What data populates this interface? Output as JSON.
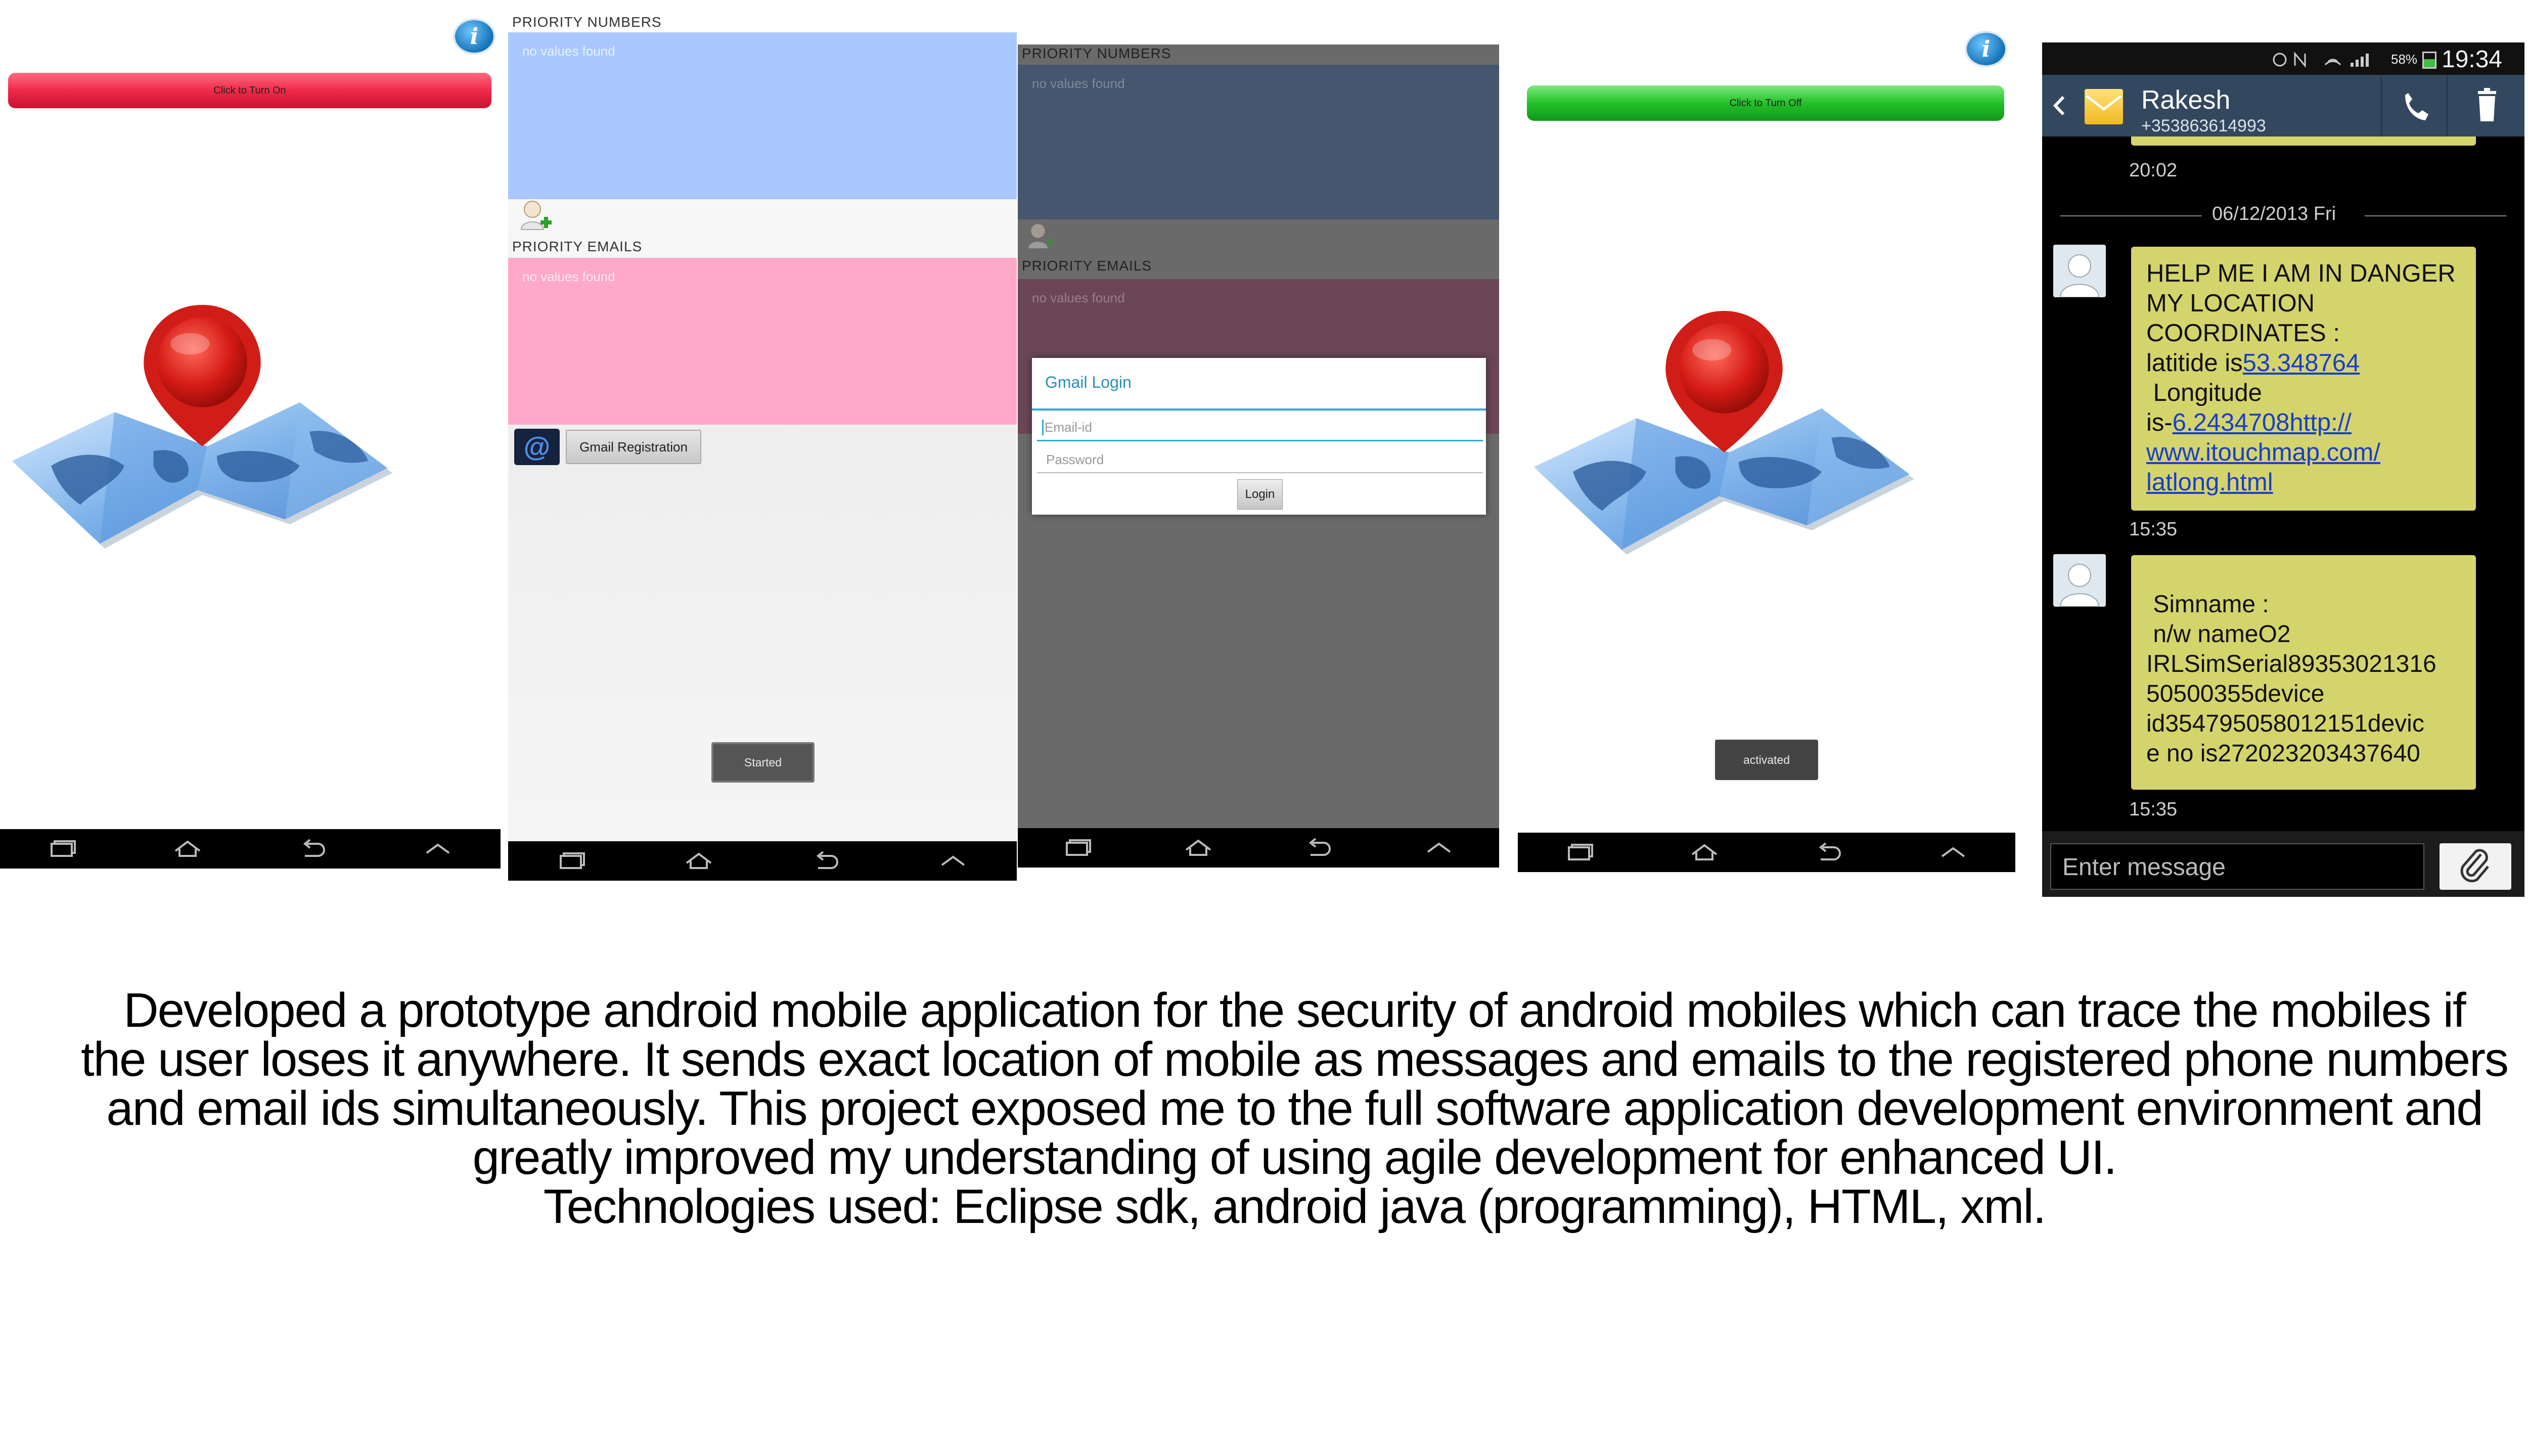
{
  "screen1": {
    "info_label": "i",
    "toggle_label": "Click to Turn On",
    "toggle_color": "#ee2a4a"
  },
  "screen2": {
    "priority_numbers_title": "PRIORITY NUMBERS",
    "numbers_empty": "no values found",
    "priority_emails_title": "PRIORITY EMAILS",
    "emails_empty": "no values found",
    "gmail_registration_label": "Gmail Registration",
    "started_label": "Started",
    "numbers_color": "#a8c8ff",
    "emails_color": "#ffa8c8"
  },
  "screen3": {
    "priority_numbers_title": "PRIORITY NUMBERS",
    "numbers_empty": "no values found",
    "priority_emails_title": "PRIORITY EMAILS",
    "emails_empty": "no values found",
    "dialog": {
      "title": "Gmail Login",
      "email_placeholder": "Email-id",
      "password_placeholder": "Password",
      "login_label": "Login"
    }
  },
  "screen4": {
    "info_label": "i",
    "toggle_label": "Click to Turn Off",
    "toggle_color": "#22c22a",
    "activated_label": "activated"
  },
  "screen5": {
    "status_bar": {
      "battery": "58%",
      "time": "19:34"
    },
    "contact_name": "Rakesh",
    "contact_number": "+353863614993",
    "earlier_time": "20:02",
    "date_divider": "06/12/2013 Fri",
    "message1": {
      "lines": [
        "HELP ME I AM IN DANGER",
        "MY LOCATION",
        "COORDINATES :"
      ],
      "latitude_prefix": "latitide is",
      "latitude_value": "53.348764",
      "longitude_label": " Longitude",
      "longitude_prefix": "is-",
      "longitude_link_1": "6.2434708http://",
      "link_2": "www.itouchmap.com/",
      "link_3": "latlong.html",
      "time": "15:35"
    },
    "message2": {
      "lines": [
        " Simname :",
        " n/w nameO2",
        "IRLSimSerial89353021316",
        "50500355device",
        "id354795058012151devic",
        "e no is272023203437640"
      ],
      "time": "15:35"
    },
    "input_placeholder": "Enter message"
  },
  "caption": {
    "line1": "Developed a prototype android mobile application for the security of android mobiles which can trace the mobiles if",
    "line2": "the user loses it anywhere. It sends exact location of mobile as messages and emails to the registered phone numbers",
    "line3": "and email ids simultaneously. This project exposed me to the full software application development environment and",
    "line4": "greatly improved my understanding of using agile development for enhanced UI.",
    "line5": "Technologies used: Eclipse sdk, android java (programming), HTML, xml."
  }
}
